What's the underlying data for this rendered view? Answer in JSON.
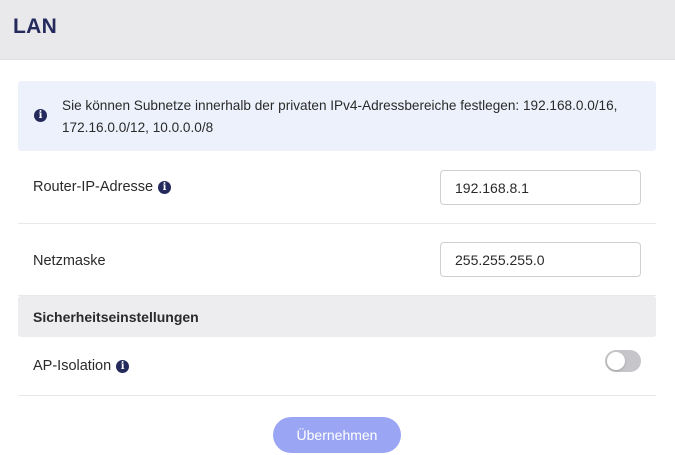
{
  "header": {
    "title": "LAN"
  },
  "info": {
    "icon": "info-circle-icon",
    "text": "Sie können Subnetze innerhalb der privaten IPv4-Adressbereiche festlegen: 192.168.0.0/16, 172.16.0.0/12, 10.0.0.0/8"
  },
  "router_ip": {
    "label": "Router-IP-Adresse",
    "value": "192.168.8.1",
    "hint_icon": "info-circle-icon"
  },
  "netmask": {
    "label": "Netzmaske",
    "value": "255.255.255.0"
  },
  "security": {
    "title": "Sicherheitseinstellungen",
    "ap_isolation": {
      "label": "AP-Isolation",
      "hint_icon": "info-circle-icon",
      "enabled": false
    }
  },
  "apply_label": "Übernehmen",
  "colors": {
    "accent": "#252a5c",
    "button": "#9aa6f4",
    "info_bg": "#edf1fc",
    "header_bg": "#e9e9ec"
  }
}
